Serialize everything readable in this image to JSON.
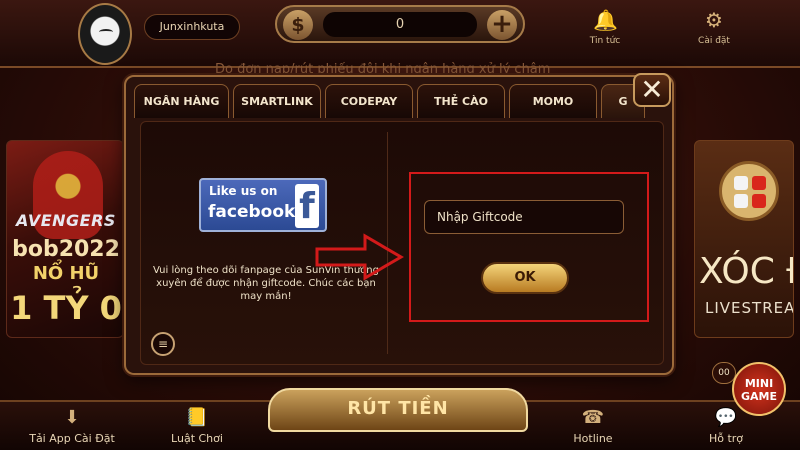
{
  "header": {
    "username": "Junxinhkuta",
    "balance": "0",
    "news_label": "Tin tức",
    "settings_label": "Cài đặt"
  },
  "notice_text": "Do đợn nạp/rút phiếu đôi khi ngân hàng xử lý chậm",
  "left_banner": {
    "line1": "AVENGERS",
    "line2": "bob2022",
    "line3": "NỔ HŨ",
    "line4": "1 TỶ 0"
  },
  "right_banner": {
    "line1": "XÓC ĐĨ",
    "line2": "LIVESTREA"
  },
  "modal": {
    "tabs": [
      "NGÂN HÀNG",
      "SMARTLINK",
      "CODEPAY",
      "THẺ CÀO",
      "MOMO",
      "G"
    ],
    "active_tab": "G",
    "close_symbol": "✕",
    "facebook": {
      "like_text": "Like us on",
      "brand_text": "facebook",
      "f_letter": "f"
    },
    "fanpage_text": "Vui lòng theo dõi fanpage của SunVin thường xuyên để được nhận giftcode. Chúc các bạn may mắn!",
    "giftcode_placeholder": "Nhập Giftcode",
    "ok_label": "OK"
  },
  "bottom": {
    "app_label": "Tải App Cài Đặt",
    "rules_label": "Luật Chơi",
    "withdraw_label": "RÚT TIỀN",
    "hotline_label": "Hotline",
    "support_label": "Hỗ trợ",
    "mini_game_label": "MINI GAME",
    "mini_timer": "00"
  },
  "colors": {
    "accent_gold": "#c79a5d",
    "highlight_red": "#d31a1a",
    "ok_button": "#f4d47a"
  }
}
